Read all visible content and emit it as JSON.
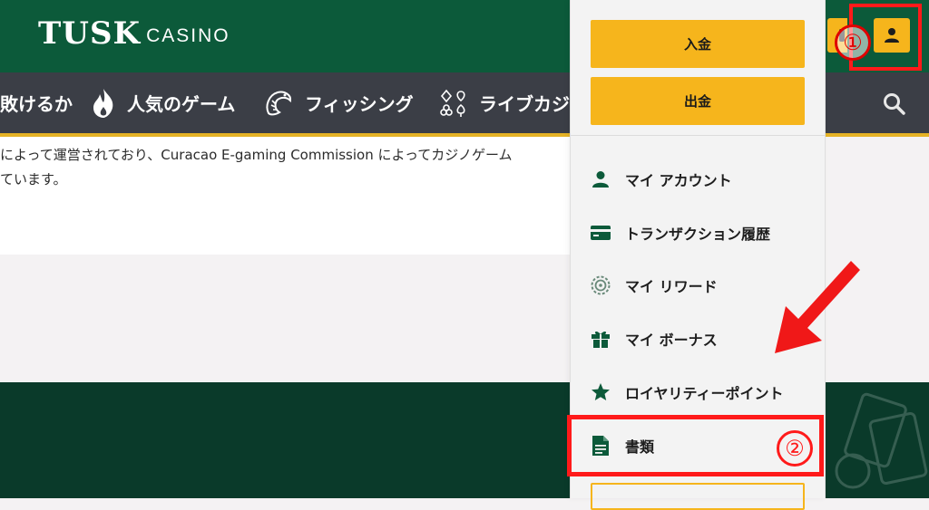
{
  "header": {
    "logo_main": "TUSK",
    "logo_sub": "CASINO"
  },
  "nav": {
    "items": [
      {
        "label": "敗けるか",
        "icon": "none"
      },
      {
        "label": "人気のゲーム",
        "icon": "flame-icon"
      },
      {
        "label": "フィッシング",
        "icon": "fish-icon"
      },
      {
        "label": "ライブカジ",
        "icon": "card-suits-icon"
      }
    ]
  },
  "content": {
    "lines": [
      "によって運営されており、Curacao E-gaming Commission によってカジノゲーム",
      "ています。"
    ]
  },
  "dropdown": {
    "deposit_label": "入金",
    "withdraw_label": "出金",
    "items": [
      {
        "label": "マイ アカウント",
        "icon": "user-icon"
      },
      {
        "label": "トランザクション履歴",
        "icon": "credit-card-icon"
      },
      {
        "label": "マイ リワード",
        "icon": "reward-wheel-icon"
      },
      {
        "label": "マイ ボーナス",
        "icon": "gift-icon"
      },
      {
        "label": "ロイヤリティーポイント",
        "icon": "star-icon"
      },
      {
        "label": "書類",
        "icon": "document-icon"
      }
    ]
  },
  "annotations": {
    "step1": "①",
    "step2": "②"
  },
  "colors": {
    "header_green": "#0c5a3a",
    "nav_dark": "#3b3e46",
    "accent_yellow": "#f6b51c",
    "footer_green": "#0a3a2a",
    "highlight_red": "#ff1a1a"
  }
}
